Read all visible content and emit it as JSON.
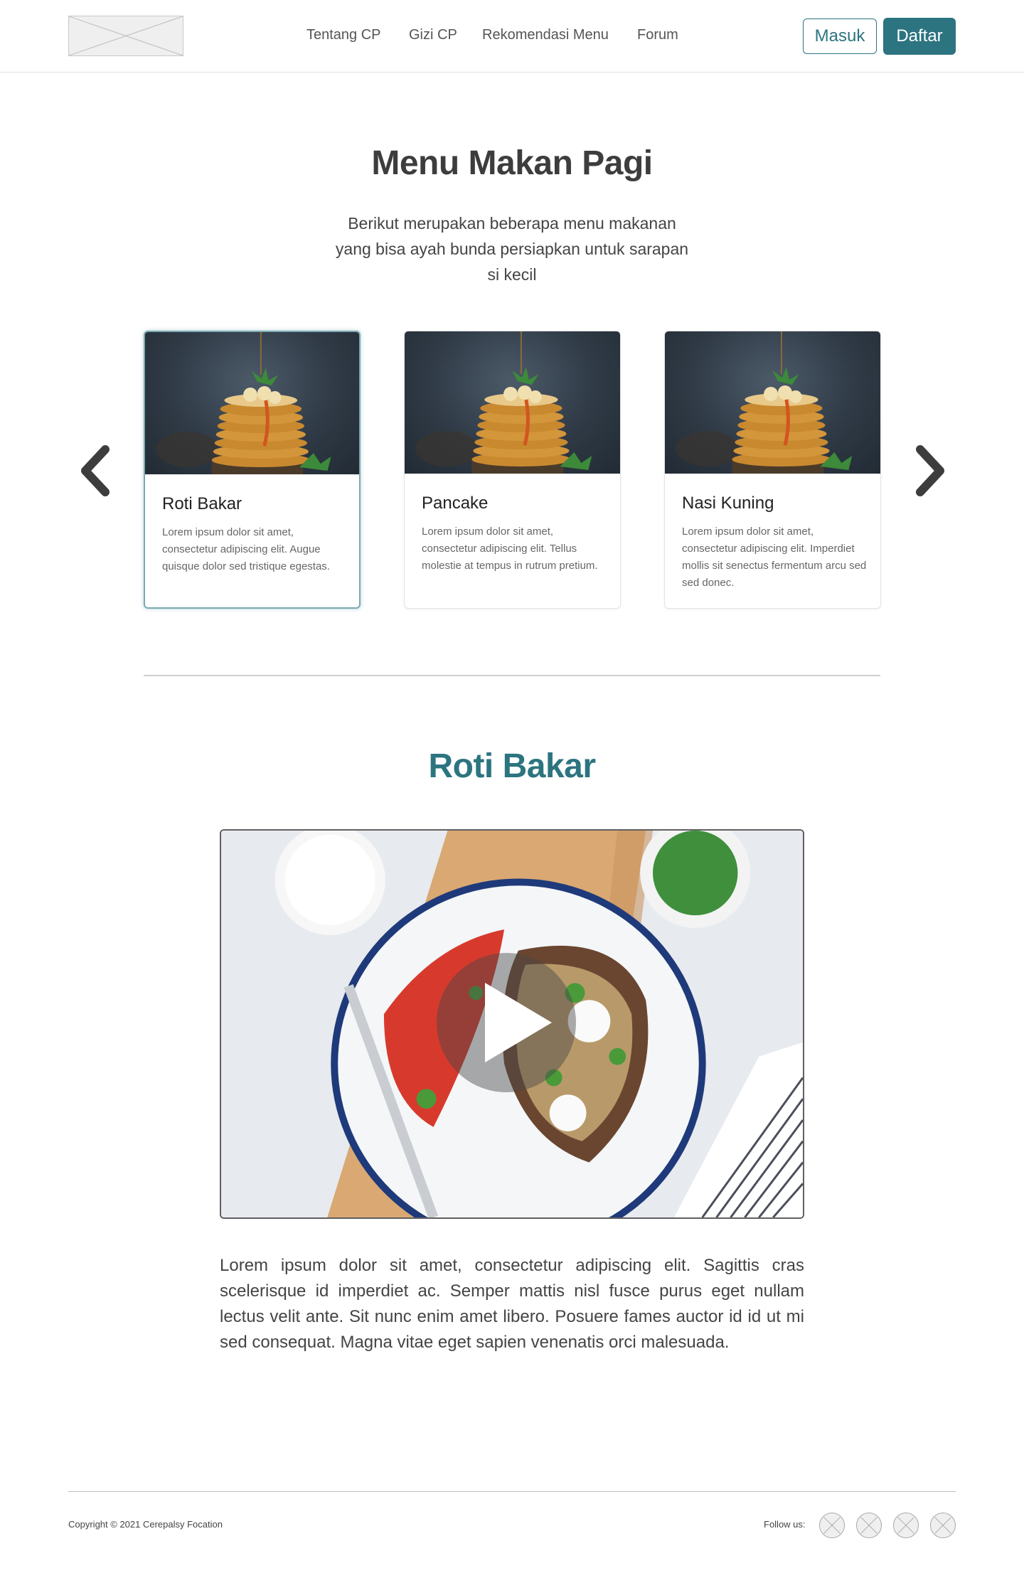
{
  "header": {
    "nav": [
      "Tentang CP",
      "Gizi CP",
      "Rekomendasi Menu",
      "Forum"
    ],
    "login_label": "Masuk",
    "register_label": "Daftar"
  },
  "hero": {
    "title": "Menu Makan Pagi",
    "subtitle": "Berikut merupakan beberapa menu makanan yang bisa ayah bunda persiapkan untuk sarapan si kecil"
  },
  "cards": [
    {
      "title": "Roti Bakar",
      "description": "Lorem ipsum dolor sit amet, consectetur adipiscing elit. Augue quisque dolor sed tristique egestas."
    },
    {
      "title": "Pancake",
      "description": "Lorem ipsum dolor sit amet, consectetur adipiscing elit. Tellus molestie at tempus in rutrum pretium."
    },
    {
      "title": "Nasi Kuning",
      "description": "Lorem ipsum dolor sit amet, consectetur adipiscing elit. Imperdiet mollis sit senectus fermentum arcu sed sed donec."
    }
  ],
  "detail": {
    "title": "Roti Bakar",
    "text": "Lorem ipsum dolor sit amet, consectetur adipiscing elit. Sagittis cras scelerisque id imperdiet ac. Semper mattis nisl fusce purus eget nullam lectus velit ante. Sit nunc enim amet libero. Posuere fames auctor id id ut mi sed consequat. Magna vitae eget sapien venenatis orci malesuada."
  },
  "footer": {
    "copyright": "Copyright © 2021 Cerepalsy Focation",
    "follow_label": "Follow us:",
    "social_icons": [
      "social-icon-placeholder",
      "social-icon-placeholder",
      "social-icon-placeholder",
      "social-icon-placeholder"
    ]
  },
  "colors": {
    "accent": "#2c7480",
    "text": "#3d3d3d"
  }
}
